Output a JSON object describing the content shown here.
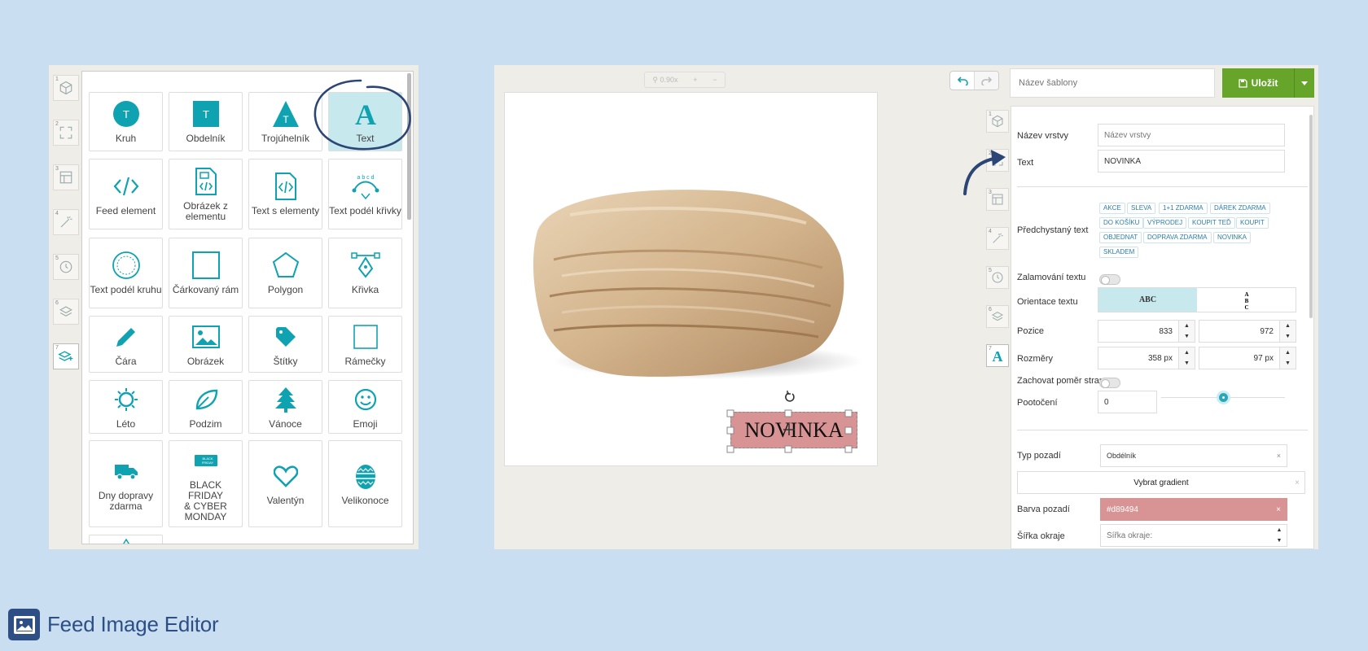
{
  "left_panel": {
    "strip_numbers": [
      "1",
      "2",
      "3",
      "4",
      "5",
      "6",
      "7"
    ],
    "tiles": [
      {
        "label": "Kruh",
        "icon": "circle-t-icon"
      },
      {
        "label": "Obdelník",
        "icon": "square-t-icon"
      },
      {
        "label": "Trojúhelník",
        "icon": "triangle-t-icon"
      },
      {
        "label": "Text",
        "icon": "text-a-icon"
      },
      {
        "label": "Feed element",
        "icon": "code-icon"
      },
      {
        "label": "Obrázek z elementu",
        "icon": "file-image-code-icon"
      },
      {
        "label": "Text s elementy",
        "icon": "file-code-icon"
      },
      {
        "label": "Text podél křivky",
        "icon": "curve-text-icon"
      },
      {
        "label": "Text podél kruhu",
        "icon": "circle-text-icon"
      },
      {
        "label": "Čárkovaný rám",
        "icon": "dashed-frame-icon"
      },
      {
        "label": "Polygon",
        "icon": "pentagon-icon"
      },
      {
        "label": "Křivka",
        "icon": "pen-tool-icon"
      },
      {
        "label": "Čára",
        "icon": "pencil-icon"
      },
      {
        "label": "Obrázek",
        "icon": "image-icon"
      },
      {
        "label": "Štítky",
        "icon": "tag-icon"
      },
      {
        "label": "Rámečky",
        "icon": "frame-icon"
      },
      {
        "label": "Léto",
        "icon": "sun-icon"
      },
      {
        "label": "Podzim",
        "icon": "leaf-icon"
      },
      {
        "label": "Vánoce",
        "icon": "tree-icon"
      },
      {
        "label": "Emoji",
        "icon": "smiley-icon"
      },
      {
        "label": "Dny dopravy zdarma",
        "icon": "truck-icon"
      },
      {
        "label": "BLACK FRIDAY & CYBER MONDAY",
        "icon": "black-friday-badge-icon"
      },
      {
        "label": "Valentýn",
        "icon": "heart-icon"
      },
      {
        "label": "Velikonoce",
        "icon": "easter-egg-icon"
      }
    ],
    "selected_tile": "Text"
  },
  "editor": {
    "zoom": "0.90x",
    "zoom_in": "+",
    "zoom_out": "−",
    "template_name_placeholder": "Název šablony",
    "save_label": "Uložit",
    "canvas_text": "NOVINKA",
    "strip_numbers": [
      "1",
      "2",
      "3",
      "4",
      "5",
      "6",
      "7"
    ]
  },
  "properties": {
    "layer_name_label": "Název vrstvy",
    "layer_name_placeholder": "Název vrstvy",
    "text_label": "Text",
    "text_value": "NOVINKA",
    "preset_label": "Předchystaný text",
    "presets": [
      "AKCE",
      "SLEVA",
      "1+1 ZDARMA",
      "DÁREK ZDARMA",
      "DO KOŠÍKU",
      "VÝPRODEJ",
      "KOUPIT TEĎ",
      "KOUPIT",
      "OBJEDNAT",
      "DOPRAVA ZDARMA",
      "NOVINKA",
      "SKLADEM"
    ],
    "wrap_label": "Zalamování textu",
    "orientation_label": "Orientace textu",
    "orientation_horizontal": "ABC",
    "position_label": "Pozice",
    "position_x": "833",
    "position_y": "972",
    "size_label": "Rozměry",
    "width": "358 px",
    "height": "97 px",
    "keep_ratio_label": "Zachovat poměr stran",
    "rotation_label": "Pootočení",
    "rotation_value": "0",
    "rotation_fraction": 0.5,
    "bg_type_label": "Typ pozadí",
    "bg_type_value": "Obdélník",
    "gradient_button": "Vybrat gradient",
    "bg_color_label": "Barva pozadí",
    "bg_color_value": "#d89494",
    "border_width_label": "Šířka okraje",
    "border_width_placeholder": "Šířka okraje:"
  },
  "colors": {
    "accent": "#0fa3b1",
    "save": "#67a52a",
    "bg_color": "#d89494",
    "brand": "#2e4f86"
  },
  "brand": {
    "name": "Feed Image Editor"
  }
}
